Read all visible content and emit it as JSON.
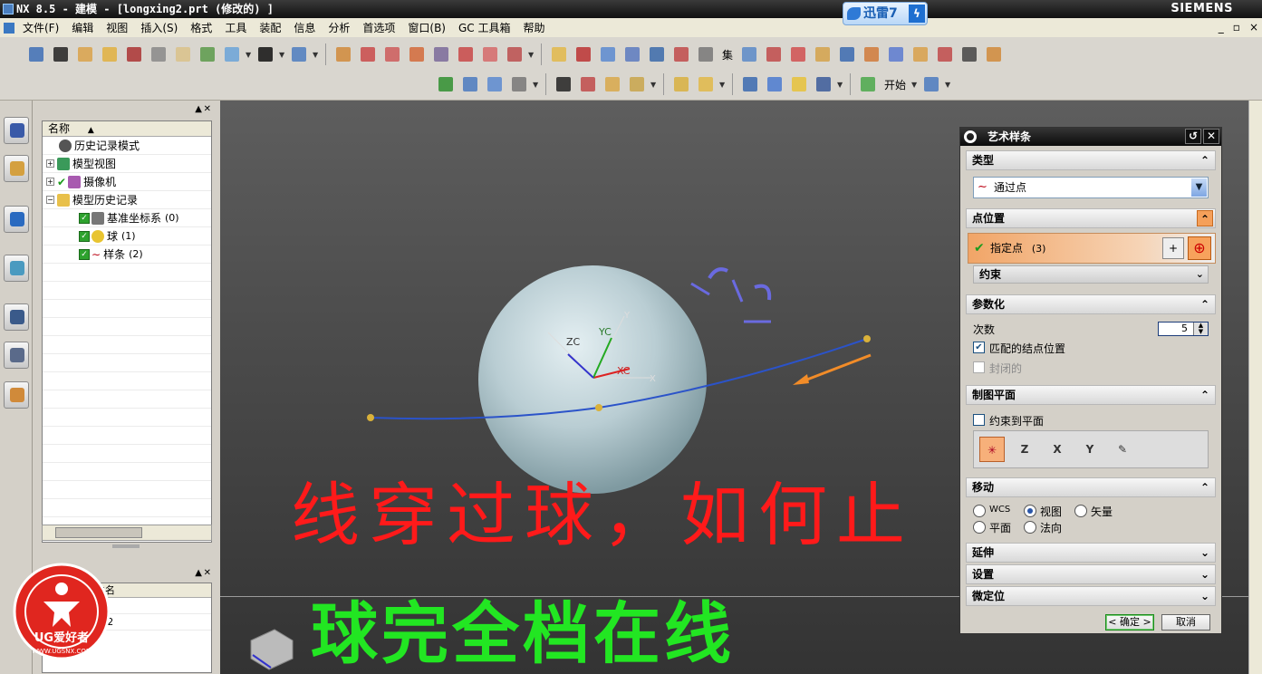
{
  "window": {
    "title": "NX 8.5 - 建模 - [longxing2.prt  (修改的) ]",
    "brand": "SIEMENS",
    "xunlei_label": "迅雷7",
    "xunlei_bolt": "ϟ"
  },
  "menu": {
    "items": [
      "文件(F)",
      "编辑",
      "视图",
      "插入(S)",
      "格式",
      "工具",
      "装配",
      "信息",
      "分析",
      "首选项",
      "窗口(B)",
      "GC 工具箱",
      "帮助"
    ],
    "window_controls": [
      "_",
      "▫",
      "×"
    ]
  },
  "toolbar": {
    "start_label": "开始",
    "ji_label": "集"
  },
  "navigator": {
    "column_header": "名称",
    "sort_arrow": "▲",
    "pin": "▲",
    "close": "✕",
    "nodes": [
      {
        "label": "历史记录模式",
        "count": ""
      },
      {
        "label": "模型视图",
        "count": ""
      },
      {
        "label": "摄像机",
        "count": ""
      },
      {
        "label": "模型历史记录",
        "count": ""
      },
      {
        "label": "基准坐标系",
        "count": "(0)"
      },
      {
        "label": "球",
        "count": "(1)"
      },
      {
        "label": "样条",
        "count": "(2)"
      }
    ],
    "part_nav_header": "相关性部件名",
    "part_rows": [
      "截面",
      "longxing2"
    ]
  },
  "viewport": {
    "axis_labels": {
      "zc": "ZC",
      "yc": "YC",
      "xc": "XC",
      "y": "Y",
      "x": "X"
    },
    "annotation_line1": "线穿过球，如何止",
    "annotation_line2": "球完全档在线",
    "colors": {
      "sphere": "#b9cdd3",
      "spline": "#2b53c9",
      "annot_red": "#ff1a1a",
      "annot_green": "#22e622"
    }
  },
  "logo": {
    "text": "UG爱好者",
    "url_text": "WWW.UGSNX.COM"
  },
  "dialog": {
    "title": "艺术样条",
    "title_buttons": [
      "↺",
      "✕"
    ],
    "sections": {
      "type": "类型",
      "point_position": "点位置",
      "parameterization": "参数化",
      "drawing_plane": "制图平面",
      "move": "移动",
      "extend": "延伸",
      "settings": "设置",
      "micro_position": "微定位"
    },
    "type_value": "通过点",
    "specify_point_label": "指定点",
    "specify_point_count": "(3)",
    "constraint_label": "约束",
    "degree_label": "次数",
    "degree_value": "5",
    "match_knots_label": "匹配的结点位置",
    "closed_label": "封闭的",
    "constrain_to_plane_label": "约束到平面",
    "plane_buttons": [
      "Z",
      "X",
      "Y"
    ],
    "move_options": [
      "WCS",
      "视图",
      "矢量",
      "平面",
      "法向"
    ],
    "move_selected": "视图",
    "ok_label": "< 确定 >",
    "cancel_label": "取消"
  }
}
